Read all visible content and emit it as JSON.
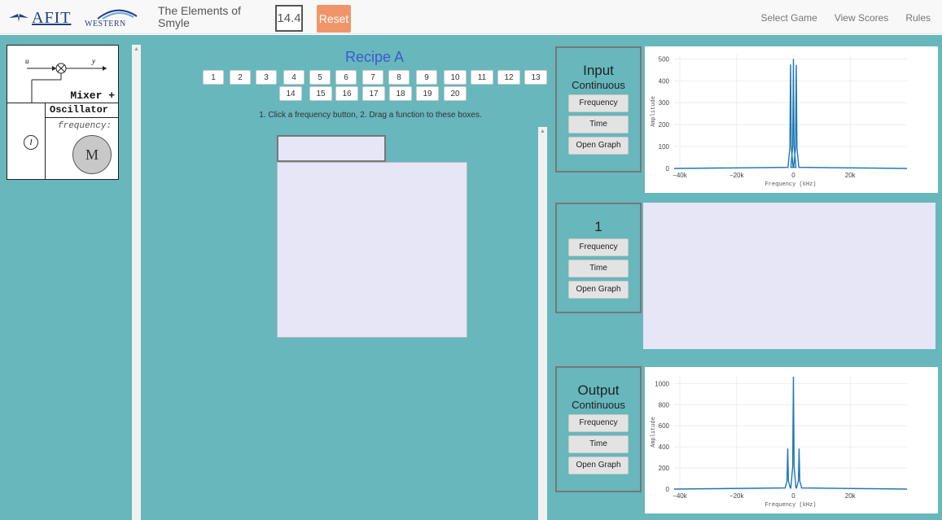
{
  "nav": {
    "afit_logo": "AFIT",
    "western_logo": "WESTERN",
    "game_title": "The Elements of Smyle",
    "score": "14.4",
    "reset_label": "Reset",
    "links": [
      "Select Game",
      "View Scores",
      "Rules"
    ]
  },
  "mixer": {
    "title": "Mixer +",
    "subtitle": "Oscillator",
    "freq_label": "frequency:",
    "knob_label": "M",
    "small_knob_label": "l",
    "in_label": "u",
    "out_label": "y"
  },
  "recipe": {
    "title": "Recipe A",
    "buttons_row1": [
      "1",
      "2",
      "3",
      "4",
      "5",
      "6",
      "7",
      "8",
      "9",
      "10",
      "11",
      "12",
      "13"
    ],
    "buttons_row2": [
      "14",
      "15",
      "16",
      "17",
      "18",
      "19",
      "20"
    ],
    "instruction": "1. Click a frequency button, 2. Drag a function to these boxes."
  },
  "cards": {
    "input": {
      "title": "Input",
      "subtitle": "Continuous",
      "btn_freq": "Frequency",
      "btn_time": "Time",
      "btn_graph": "Open Graph"
    },
    "stage": {
      "title": "1",
      "btn_freq": "Frequency",
      "btn_time": "Time",
      "btn_graph": "Open Graph"
    },
    "output": {
      "title": "Output",
      "subtitle": "Continuous",
      "btn_freq": "Frequency",
      "btn_time": "Time",
      "btn_graph": "Open Graph"
    }
  },
  "chart_data": [
    {
      "type": "line",
      "xlabel": "Frequency (kHz)",
      "ylabel": "Amplitude",
      "xlim": [
        -42,
        40
      ],
      "ylim": [
        0,
        520
      ],
      "xticks": [
        "−40k",
        "−20k",
        "0",
        "20k"
      ],
      "xtick_values": [
        -40,
        -20,
        0,
        20
      ],
      "yticks": [
        "0",
        "100",
        "200",
        "300",
        "400",
        "500"
      ],
      "ytick_values": [
        0,
        100,
        200,
        300,
        400,
        500
      ],
      "series": [
        {
          "peaks": [
            {
              "x": -1,
              "y": 475
            },
            {
              "x": 0,
              "y": 500
            },
            {
              "x": 1,
              "y": 472
            }
          ]
        }
      ],
      "color": "#1f77b4",
      "grid": true
    },
    {
      "type": "line",
      "xlabel": "Frequency (kHz)",
      "ylabel": "Amplitude",
      "xlim": [
        -42,
        40
      ],
      "ylim": [
        0,
        1080
      ],
      "xticks": [
        "−40k",
        "−20k",
        "0",
        "20k"
      ],
      "xtick_values": [
        -40,
        -20,
        0,
        20
      ],
      "yticks": [
        "0",
        "200",
        "400",
        "600",
        "800",
        "1000"
      ],
      "ytick_values": [
        0,
        200,
        400,
        600,
        800,
        1000
      ],
      "series": [
        {
          "peaks": [
            {
              "x": -2,
              "y": 385
            },
            {
              "x": 0,
              "y": 1065
            },
            {
              "x": 2,
              "y": 385
            }
          ]
        }
      ],
      "color": "#1f77b4",
      "grid": true
    }
  ]
}
